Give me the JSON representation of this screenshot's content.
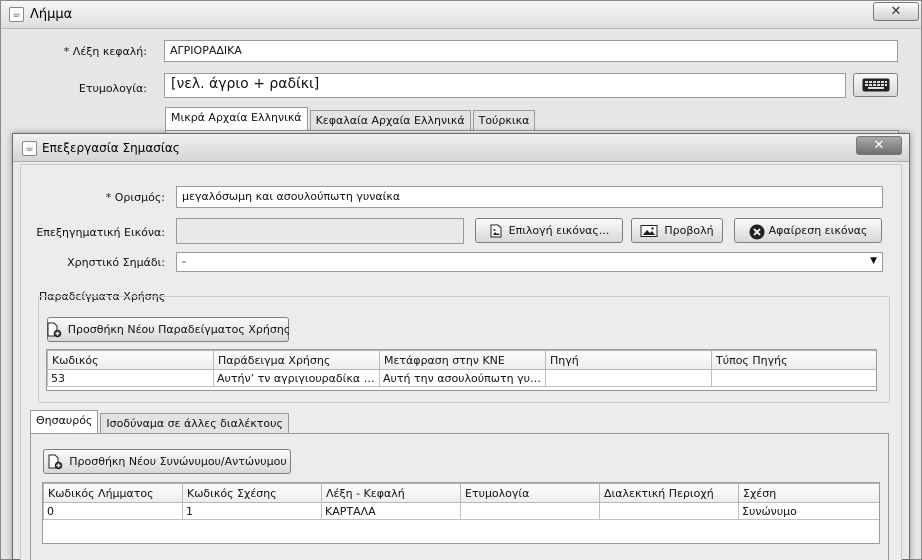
{
  "outer": {
    "title": "Λήμμα",
    "headword_label": "* Λέξη κεφαλή:",
    "headword_value": "ΑΓΡΙΟΡΑΔΙΚΑ",
    "etymology_label": "Ετυμολογία:",
    "etymology_value": "[νελ. άγριο +  ραδίκι]",
    "tabs": [
      "Μικρά Αρχαία Ελληνικά",
      "Κεφαλαία Αρχαία Ελληνικά",
      "Τούρκικα"
    ]
  },
  "dialog": {
    "title": "Επεξεργασία Σημασίας",
    "definition_label": "* Ορισμός:",
    "definition_value": "μεγαλόσωμη και ασουλούπωτη γυναίκα",
    "image_label": "Επεξηγηματική Εικόνα:",
    "choose_image": "Επιλογή εικόνας...",
    "view": "Προβολή",
    "remove_image": "Αφαίρεση εικόνας",
    "usage_label": "Χρηστικό Σημάδι:",
    "usage_value": "-",
    "examples_group": "Παραδείγματα Χρήσης",
    "add_example": "Προσθήκη Νέου Παραδείγματος Χρήσης",
    "examples_table": {
      "headers": [
        "Κωδικός",
        "Παράδειγμα Χρήσης",
        "Μετάφραση στην ΚΝΕ",
        "Πηγή",
        "Τύπος Πηγής"
      ],
      "rows": [
        [
          "53",
          "Αυτήν’ τν αγριγιουραδίκα τίλου…",
          "Αυτή την ασουλούπωτη γυναίκ…",
          "",
          ""
        ]
      ]
    },
    "tabs": [
      "Θησαυρός",
      "Ισοδύναμα σε άλλες διαλέκτους"
    ],
    "add_synonym": "Προσθήκη Νέου Συνώνυμου/Αντώνυμου",
    "thesaurus_table": {
      "headers": [
        "Κωδικός Λήμματος",
        "Κωδικός Σχέσης",
        "Λέξη - Κεφαλή",
        "Ετυμολογία",
        "Διαλεκτική Περιοχή",
        "Σχέση"
      ],
      "rows": [
        [
          "0",
          "1",
          "ΚΑΡΤΑΛΑ",
          "",
          "",
          "Συνώνυμο"
        ]
      ]
    }
  }
}
